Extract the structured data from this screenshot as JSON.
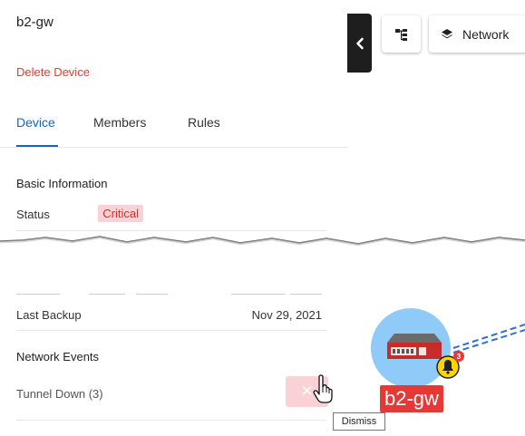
{
  "device": {
    "name": "b2-gw",
    "delete_label": "Delete Device"
  },
  "tabs": [
    {
      "label": "Device",
      "active": true
    },
    {
      "label": "Members",
      "active": false
    },
    {
      "label": "Rules",
      "active": false
    }
  ],
  "basic_info": {
    "title": "Basic Information",
    "status_label": "Status",
    "status_value": "Critical"
  },
  "backup": {
    "label": "Last Backup",
    "value": "Nov 29, 2021"
  },
  "network_events": {
    "title": "Network Events",
    "items": [
      {
        "label": "Tunnel Down (3)"
      }
    ],
    "dismiss_tooltip": "Dismiss"
  },
  "toolbar": {
    "network_label": "Network"
  },
  "map": {
    "node_label": "b2-gw",
    "alert_count": "3"
  },
  "icons": {
    "collapse": "chevron-left-icon",
    "topology": "topology-icon",
    "layers": "layers-icon",
    "dismiss": "close-icon",
    "cursor": "hand-cursor-icon",
    "device": "router-icon",
    "alert": "bell-icon"
  },
  "colors": {
    "accent": "#1565c0",
    "critical": "#d32f2f",
    "critical_bg": "#fad2d5",
    "delete": "#e53935",
    "node_bg": "#90caf9"
  }
}
